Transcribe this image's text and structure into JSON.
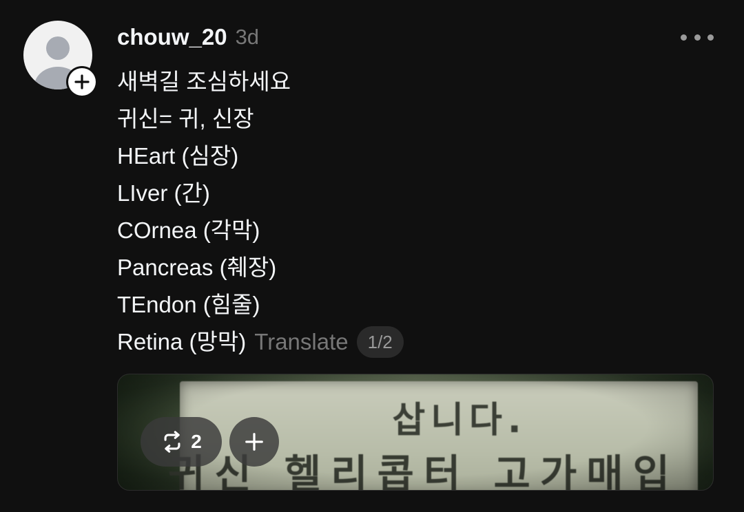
{
  "post": {
    "username": "chouw_20",
    "timestamp": "3d",
    "lines": [
      "새벽길 조심하세요",
      "귀신= 귀, 신장",
      "HEart (심장)",
      "LIver (간)",
      "COrnea (각막)",
      "Pancreas (췌장)",
      "TEndon (힘줄)",
      "Retina (망막)"
    ],
    "translate_label": "Translate",
    "page_indicator": "1/2"
  },
  "media": {
    "sign_line1": "삽니다.",
    "sign_line2": "귀신 헬리콥터 고가매입",
    "repost_count": "2"
  },
  "icons": {
    "avatar": "default-user-avatar",
    "follow": "plus-icon",
    "more": "more-dots-icon",
    "repost": "repost-icon",
    "add": "plus-icon"
  }
}
